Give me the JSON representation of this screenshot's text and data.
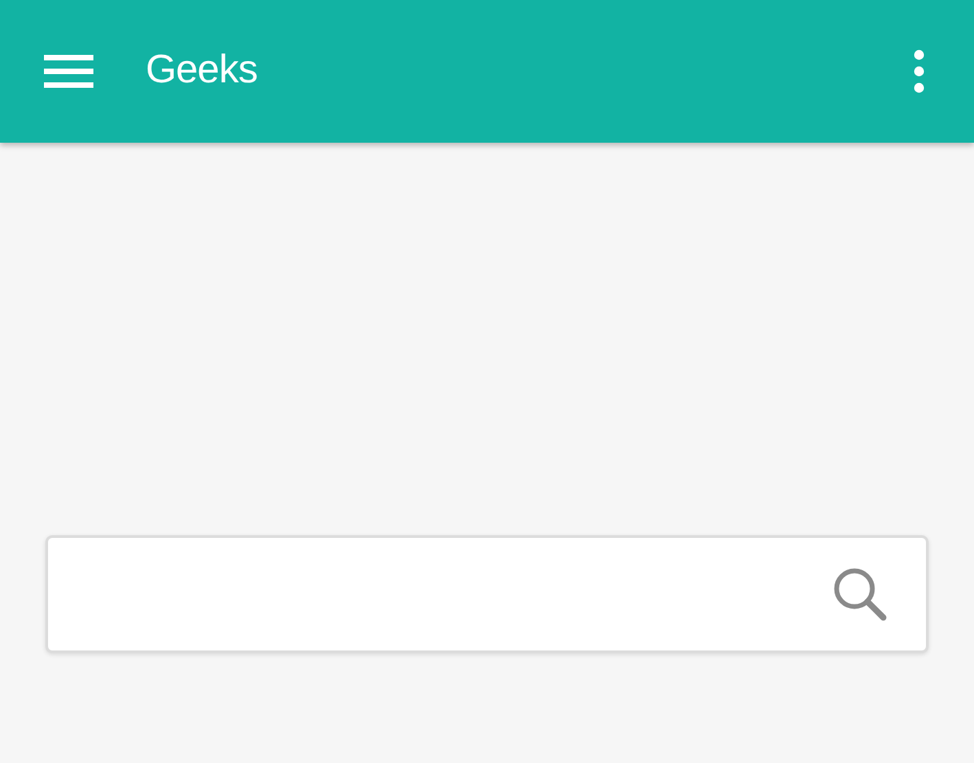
{
  "app_bar": {
    "title": "Geeks"
  },
  "search_field": {
    "kind": "text"
  }
}
